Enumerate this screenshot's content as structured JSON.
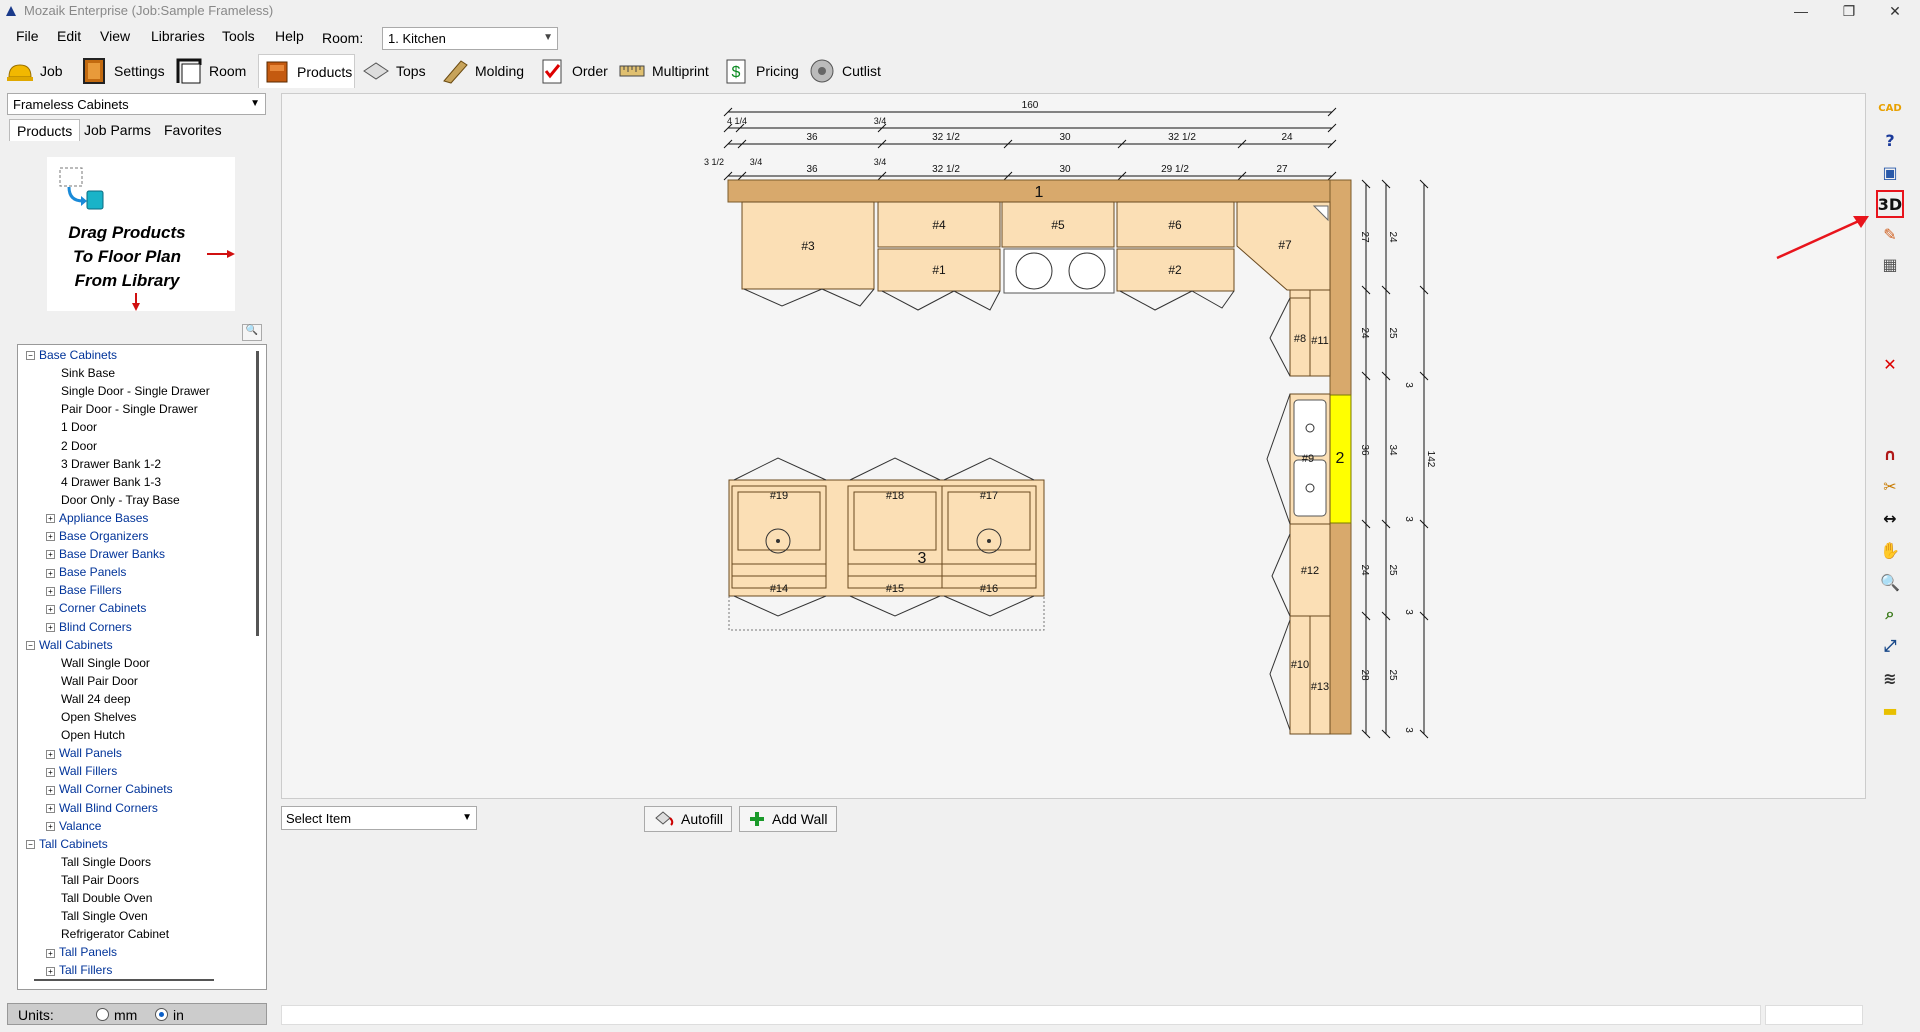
{
  "window": {
    "title": "Mozaik Enterprise (Job:Sample Frameless)",
    "minimize": "—",
    "restore": "❐",
    "close": "✕"
  },
  "menu": {
    "items": [
      "File",
      "Edit",
      "View",
      "Libraries",
      "Tools",
      "Help"
    ],
    "room_label": "Room:",
    "room_value": "1. Kitchen"
  },
  "toolbar": {
    "items": [
      "Job",
      "Settings",
      "Room",
      "Products",
      "Tops",
      "Molding",
      "Order",
      "Multiprint",
      "Pricing",
      "Cutlist"
    ],
    "selected": "Products"
  },
  "left": {
    "category": "Frameless Cabinets",
    "tabs": [
      "Products",
      "Job Parms",
      "Favorites"
    ],
    "drag_hint": [
      "Drag Products",
      "To Floor Plan",
      "From Library"
    ],
    "search_icon": "🔍",
    "tree": [
      {
        "label": "Base Cabinets",
        "type": "root",
        "exp": "−"
      },
      {
        "label": "Sink Base",
        "type": "leaf"
      },
      {
        "label": "Single Door - Single Drawer",
        "type": "leaf"
      },
      {
        "label": "Pair Door - Single Drawer",
        "type": "leaf"
      },
      {
        "label": "1 Door",
        "type": "leaf"
      },
      {
        "label": "2 Door",
        "type": "leaf"
      },
      {
        "label": "3 Drawer Bank 1-2",
        "type": "leaf"
      },
      {
        "label": "4 Drawer Bank 1-3",
        "type": "leaf"
      },
      {
        "label": "Door Only - Tray Base",
        "type": "leaf"
      },
      {
        "label": "Appliance Bases",
        "type": "group",
        "exp": "+"
      },
      {
        "label": "Base Organizers",
        "type": "group",
        "exp": "+"
      },
      {
        "label": "Base Drawer Banks",
        "type": "group",
        "exp": "+"
      },
      {
        "label": "Base Panels",
        "type": "group",
        "exp": "+"
      },
      {
        "label": "Base Fillers",
        "type": "group",
        "exp": "+"
      },
      {
        "label": "Corner Cabinets",
        "type": "group",
        "exp": "+"
      },
      {
        "label": "Blind Corners",
        "type": "group",
        "exp": "+"
      },
      {
        "label": "Wall Cabinets",
        "type": "root",
        "exp": "−"
      },
      {
        "label": "Wall Single Door",
        "type": "leaf"
      },
      {
        "label": "Wall Pair Door",
        "type": "leaf"
      },
      {
        "label": "Wall 24 deep",
        "type": "leaf"
      },
      {
        "label": "Open Shelves",
        "type": "leaf"
      },
      {
        "label": "Open Hutch",
        "type": "leaf"
      },
      {
        "label": "Wall Panels",
        "type": "group",
        "exp": "+"
      },
      {
        "label": "Wall Fillers",
        "type": "group",
        "exp": "+"
      },
      {
        "label": "Wall Corner Cabinets",
        "type": "group",
        "exp": "+"
      },
      {
        "label": "Wall Blind Corners",
        "type": "group",
        "exp": "+"
      },
      {
        "label": "Valance",
        "type": "group",
        "exp": "+"
      },
      {
        "label": "Tall Cabinets",
        "type": "root",
        "exp": "−"
      },
      {
        "label": "Tall Single Doors",
        "type": "leaf"
      },
      {
        "label": "Tall Pair Doors",
        "type": "leaf"
      },
      {
        "label": "Tall Double Oven",
        "type": "leaf"
      },
      {
        "label": "Tall Single Oven",
        "type": "leaf"
      },
      {
        "label": "Refrigerator Cabinet",
        "type": "leaf"
      },
      {
        "label": "Tall Panels",
        "type": "group",
        "exp": "+"
      },
      {
        "label": "Tall Fillers",
        "type": "group",
        "exp": "+"
      }
    ],
    "units": {
      "label": "Units:",
      "mm": "mm",
      "in": "in",
      "selected": "in"
    }
  },
  "plan": {
    "dims_top": {
      "total": "160",
      "r1": [
        "4 1/4",
        "3/4"
      ],
      "r2": [
        "36",
        "32 1/2",
        "30",
        "32 1/2",
        "24"
      ],
      "r3a": [
        "3 1/2",
        "3/4",
        "3/4"
      ],
      "r3": [
        "36",
        "32 1/2",
        "30",
        "29 1/2",
        "27"
      ]
    },
    "dims_right": {
      "a": [
        "27",
        "24",
        "36",
        "24",
        "28"
      ],
      "b": [
        "24",
        "25",
        "34",
        "25",
        "25"
      ],
      "c": [
        "3",
        "3",
        "3",
        "3"
      ],
      "total": "142"
    },
    "walls": [
      "1",
      "2",
      "3"
    ],
    "cabinets": [
      "#3",
      "#4",
      "#5",
      "#6",
      "#7",
      "#1",
      "#2",
      "#8",
      "#11",
      "#9",
      "#12",
      "#10",
      "#13",
      "#19",
      "#18",
      "#17",
      "#14",
      "#15",
      "#16"
    ]
  },
  "bottom": {
    "select_item": "Select Item",
    "autofill": "Autofill",
    "add_wall": "Add Wall"
  },
  "right_tools": [
    "cad-icon",
    "help-icon",
    "save-icon",
    "view-3d-icon",
    "eraser-icon",
    "grid-icon",
    "delete-icon",
    "magnet-icon",
    "tools-icon",
    "dimension-icon",
    "hand-icon",
    "zoom-icon",
    "zoom-window-icon",
    "zoom-extents-icon",
    "layers-icon",
    "note-icon"
  ],
  "colors": {
    "cabinet": "#fbdfb5",
    "counter": "#d8a96c",
    "wall_highlight": "#ffff00",
    "accent_red": "#e8141c"
  }
}
